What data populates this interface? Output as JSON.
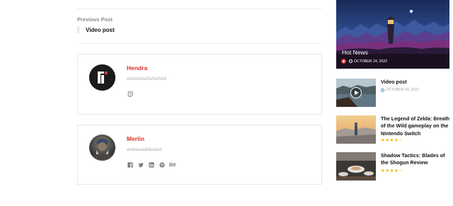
{
  "post_nav": {
    "label": "Previous Post",
    "title": "Video post"
  },
  "authors": [
    {
      "name": "Hendra",
      "description": "AAAAAAAAAAAAA",
      "socials": [
        "twitch-icon"
      ]
    },
    {
      "name": "Merlin",
      "description": "asddasaddasasd",
      "socials": [
        "facebook-icon",
        "twitter-icon",
        "linkedin-icon",
        "pinterest-icon",
        "behance-icon"
      ],
      "behance_text": "Bē"
    }
  ],
  "hero": {
    "title": "Hot News",
    "date": "OCTOBER 24, 2022"
  },
  "sidebar_posts": [
    {
      "title": "Video post",
      "date": "OCTOBER 10, 2022"
    },
    {
      "title": "The Legend of Zelda: Breath of the Wild gameplay on the Nintendo Switch",
      "rating": 4
    },
    {
      "title": "Shadow Tactics: Blades of the Shogun Review",
      "rating": 4
    }
  ],
  "colors": {
    "accent": "#d9332b",
    "star": "#f5b301"
  }
}
